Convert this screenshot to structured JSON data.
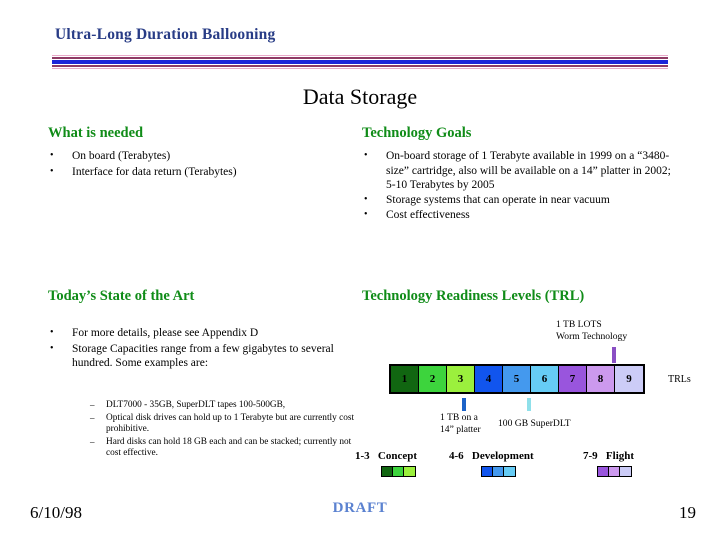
{
  "header": {
    "program_title": "Ultra-Long Duration Ballooning",
    "slide_title": "Data Storage"
  },
  "sections": {
    "what_is_needed": {
      "heading": "What is needed",
      "bullets": [
        "On board (Terabytes)",
        "Interface for data return (Terabytes)"
      ]
    },
    "technology_goals": {
      "heading": "Technology Goals",
      "bullets": [
        "On-board storage of 1 Terabyte available in 1999 on a “3480-size” cartridge, also will be available on a 14” platter in 2002; 5-10 Terabytes by 2005",
        " Storage systems that can operate in near vacuum",
        "Cost effectiveness"
      ]
    },
    "state_of_the_art": {
      "heading": "Today’s State of the Art",
      "bullets": [
        "For more details, please see Appendix D",
        "Storage Capacities range from a few gigabytes to several hundred.  Some examples are:"
      ],
      "sub_bullets": [
        "DLT7000 - 35GB, SuperDLT tapes 100-500GB,",
        "Optical disk drives can hold up to 1 Terabyte but are currently cost prohibitive.",
        "Hard disks can hold 18 GB each and can be stacked; currently not  cost effective."
      ]
    },
    "trl": {
      "heading": "Technology Readiness Levels (TRL)",
      "axis_label": "TRLs",
      "callouts": [
        {
          "id": "lots",
          "text_line1": "1 TB LOTS",
          "text_line2": "Worm Technology",
          "points_to_level": 7,
          "tick_color": "#8a4fc4"
        },
        {
          "id": "platter",
          "text_line1": "1 TB on a",
          "text_line2": "14” platter",
          "points_to_level": 4,
          "tick_color": "#1c63c8"
        },
        {
          "id": "superdlt",
          "text_line1": "100 GB SuperDLT",
          "text_line2": "",
          "points_to_level": 6,
          "tick_color": "#8fe0ea"
        }
      ],
      "levels": [
        {
          "number": "1",
          "color": "#116611"
        },
        {
          "number": "2",
          "color": "#3dd43d"
        },
        {
          "number": "3",
          "color": "#9bf03d"
        },
        {
          "number": "4",
          "color": "#1155ee"
        },
        {
          "number": "5",
          "color": "#4499ee"
        },
        {
          "number": "6",
          "color": "#66ccf5"
        },
        {
          "number": "7",
          "color": "#9955dd"
        },
        {
          "number": "8",
          "color": "#cc99ee"
        },
        {
          "number": "9",
          "color": "#ccccf7"
        }
      ],
      "legend": [
        {
          "range": "1-3",
          "label": "Concept",
          "colors": [
            "#116611",
            "#3dd43d",
            "#9bf03d"
          ]
        },
        {
          "range": "4-6",
          "label": "Development",
          "colors": [
            "#1155ee",
            "#4499ee",
            "#66ccf5"
          ]
        },
        {
          "range": "7-9",
          "label": "Flight",
          "colors": [
            "#9955dd",
            "#cc99ee",
            "#ccccf7"
          ]
        }
      ]
    }
  },
  "footer": {
    "date": "6/10/98",
    "status": "DRAFT",
    "page_number": "19"
  },
  "bullet_glyph": "•",
  "dash_glyph": "–",
  "colors": {
    "title_blue": "#283c86",
    "heading_green": "#108c18",
    "draft_blue": "#5b82d0",
    "rule_blue": "#1a24d8",
    "rule_maroon": "#8e3a64",
    "rule_pink": "#e9a8c9"
  }
}
